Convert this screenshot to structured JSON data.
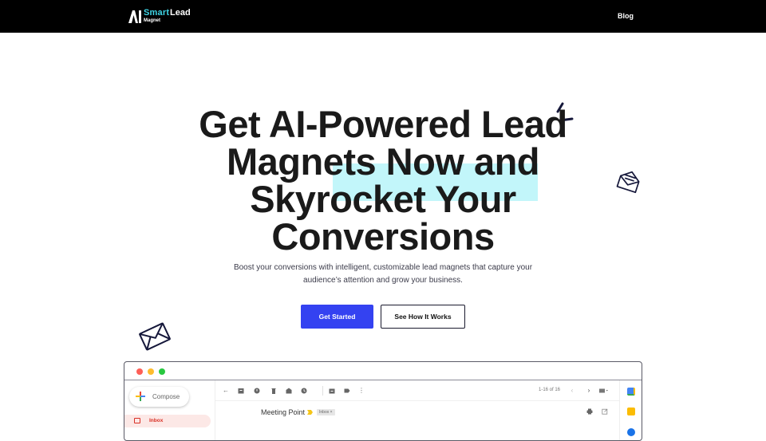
{
  "nav": {
    "logo": {
      "mark": "AI",
      "smart": "Smart",
      "lead": "Lead",
      "magnet": "Magnet"
    },
    "links": [
      {
        "label": "Blog"
      }
    ]
  },
  "hero": {
    "title": "Get AI-Powered Lead Magnets Now and Skyrocket Your Conversions",
    "subtitle": "Boost your conversions with intelligent, customizable lead magnets that capture your audience’s attention and grow your business.",
    "primary_cta": "Get Started",
    "secondary_cta": "See How It Works"
  },
  "colors": {
    "brand_accent": "#3fd6e6",
    "primary_button": "#3442f1",
    "highlight": "#c2f6fa",
    "nav_bg": "#000000"
  },
  "mock_email": {
    "compose_label": "Compose",
    "sidebar_items": [
      {
        "label": "Inbox",
        "active": true
      }
    ],
    "toolbar_icons": [
      "back-arrow-icon",
      "archive-icon",
      "report-spam-icon",
      "delete-icon",
      "mark-unread-icon",
      "snooze-icon",
      "move-to-icon",
      "label-icon",
      "more-vert-icon"
    ],
    "pager_text": "1-16 of 16",
    "subject": "Meeting Point",
    "chip_label": "Inbox ×",
    "side_apps": [
      "calendar-icon",
      "keep-icon",
      "tasks-icon"
    ]
  }
}
